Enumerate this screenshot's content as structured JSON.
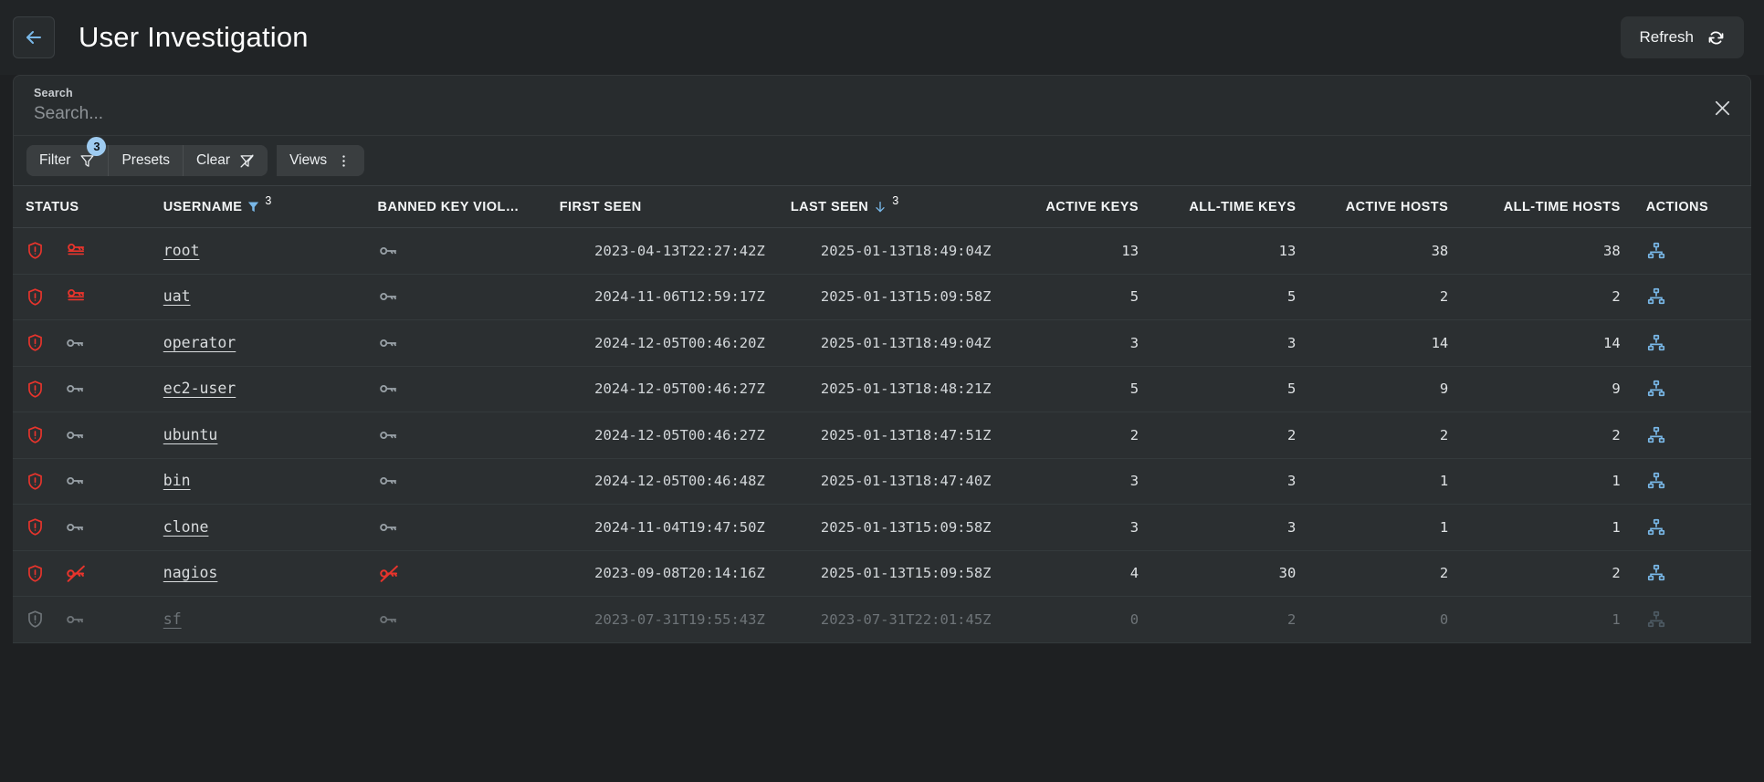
{
  "header": {
    "back_icon": "arrow-left-icon",
    "title": "User Investigation",
    "refresh_label": "Refresh",
    "refresh_icon": "refresh-icon"
  },
  "search": {
    "label": "Search",
    "placeholder": "Search...",
    "value": "",
    "clear_icon": "close-icon"
  },
  "toolbar": {
    "filter_label": "Filter",
    "filter_icon": "funnel-icon",
    "filter_badge": "3",
    "presets_label": "Presets",
    "clear_label": "Clear",
    "clear_icon": "funnel-off-icon",
    "views_label": "Views",
    "views_icon": "dots-vertical-icon"
  },
  "table": {
    "columns": [
      {
        "label": "STATUS",
        "align": "left",
        "indicator": null
      },
      {
        "label": "USERNAME",
        "align": "left",
        "indicator": "filter",
        "count": "3"
      },
      {
        "label": "BANNED KEY VIOL…",
        "align": "left",
        "indicator": null
      },
      {
        "label": "FIRST SEEN",
        "align": "left",
        "indicator": null
      },
      {
        "label": "LAST SEEN",
        "align": "left",
        "indicator": "sort-desc",
        "count": "3"
      },
      {
        "label": "ACTIVE KEYS",
        "align": "right",
        "indicator": null
      },
      {
        "label": "ALL-TIME KEYS",
        "align": "right",
        "indicator": null
      },
      {
        "label": "ACTIVE HOSTS",
        "align": "right",
        "indicator": null
      },
      {
        "label": "ALL-TIME HOSTS",
        "align": "right",
        "indicator": null
      },
      {
        "label": "ACTIONS",
        "align": "left",
        "indicator": null
      }
    ],
    "rows": [
      {
        "shield": "alert",
        "key_status": "keys-stacked-alert",
        "username": "root",
        "banned_key": "key",
        "first_seen": "2023-04-13T22:27:42Z",
        "last_seen": "2025-01-13T18:49:04Z",
        "active_keys": "13",
        "all_time_keys": "13",
        "active_hosts": "38",
        "all_time_hosts": "38",
        "action_icon": "sitemap-icon",
        "dim": false
      },
      {
        "shield": "alert",
        "key_status": "keys-stacked-alert",
        "username": "uat",
        "banned_key": "key",
        "first_seen": "2024-11-06T12:59:17Z",
        "last_seen": "2025-01-13T15:09:58Z",
        "active_keys": "5",
        "all_time_keys": "5",
        "active_hosts": "2",
        "all_time_hosts": "2",
        "action_icon": "sitemap-icon",
        "dim": false
      },
      {
        "shield": "alert",
        "key_status": "key",
        "username": "operator",
        "banned_key": "key",
        "first_seen": "2024-12-05T00:46:20Z",
        "last_seen": "2025-01-13T18:49:04Z",
        "active_keys": "3",
        "all_time_keys": "3",
        "active_hosts": "14",
        "all_time_hosts": "14",
        "action_icon": "sitemap-icon",
        "dim": false
      },
      {
        "shield": "alert",
        "key_status": "key",
        "username": "ec2-user",
        "banned_key": "key",
        "first_seen": "2024-12-05T00:46:27Z",
        "last_seen": "2025-01-13T18:48:21Z",
        "active_keys": "5",
        "all_time_keys": "5",
        "active_hosts": "9",
        "all_time_hosts": "9",
        "action_icon": "sitemap-icon",
        "dim": false
      },
      {
        "shield": "alert",
        "key_status": "key",
        "username": "ubuntu",
        "banned_key": "key",
        "first_seen": "2024-12-05T00:46:27Z",
        "last_seen": "2025-01-13T18:47:51Z",
        "active_keys": "2",
        "all_time_keys": "2",
        "active_hosts": "2",
        "all_time_hosts": "2",
        "action_icon": "sitemap-icon",
        "dim": false
      },
      {
        "shield": "alert",
        "key_status": "key",
        "username": "bin",
        "banned_key": "key",
        "first_seen": "2024-12-05T00:46:48Z",
        "last_seen": "2025-01-13T18:47:40Z",
        "active_keys": "3",
        "all_time_keys": "3",
        "active_hosts": "1",
        "all_time_hosts": "1",
        "action_icon": "sitemap-icon",
        "dim": false
      },
      {
        "shield": "alert",
        "key_status": "key",
        "username": "clone",
        "banned_key": "key",
        "first_seen": "2024-11-04T19:47:50Z",
        "last_seen": "2025-01-13T15:09:58Z",
        "active_keys": "3",
        "all_time_keys": "3",
        "active_hosts": "1",
        "all_time_hosts": "1",
        "action_icon": "sitemap-icon",
        "dim": false
      },
      {
        "shield": "alert",
        "key_status": "key-off-alert",
        "username": "nagios",
        "banned_key": "key-off-alert",
        "first_seen": "2023-09-08T20:14:16Z",
        "last_seen": "2025-01-13T15:09:58Z",
        "active_keys": "4",
        "all_time_keys": "30",
        "active_hosts": "2",
        "all_time_hosts": "2",
        "action_icon": "sitemap-icon",
        "dim": false
      },
      {
        "shield": "muted",
        "key_status": "key",
        "username": "sf",
        "banned_key": "key",
        "first_seen": "2023-07-31T19:55:43Z",
        "last_seen": "2023-07-31T22:01:45Z",
        "active_keys": "0",
        "all_time_keys": "2",
        "active_hosts": "0",
        "all_time_hosts": "1",
        "action_icon": "sitemap-icon",
        "dim": true
      }
    ]
  },
  "colors": {
    "accent_blue": "#79b8e8",
    "alert_red": "#e8342c",
    "muted_gray": "#6e7478",
    "icon_gray": "#98a0a6",
    "background": "#1e2022",
    "panel": "#282c2e",
    "row": "#2b2f31"
  }
}
